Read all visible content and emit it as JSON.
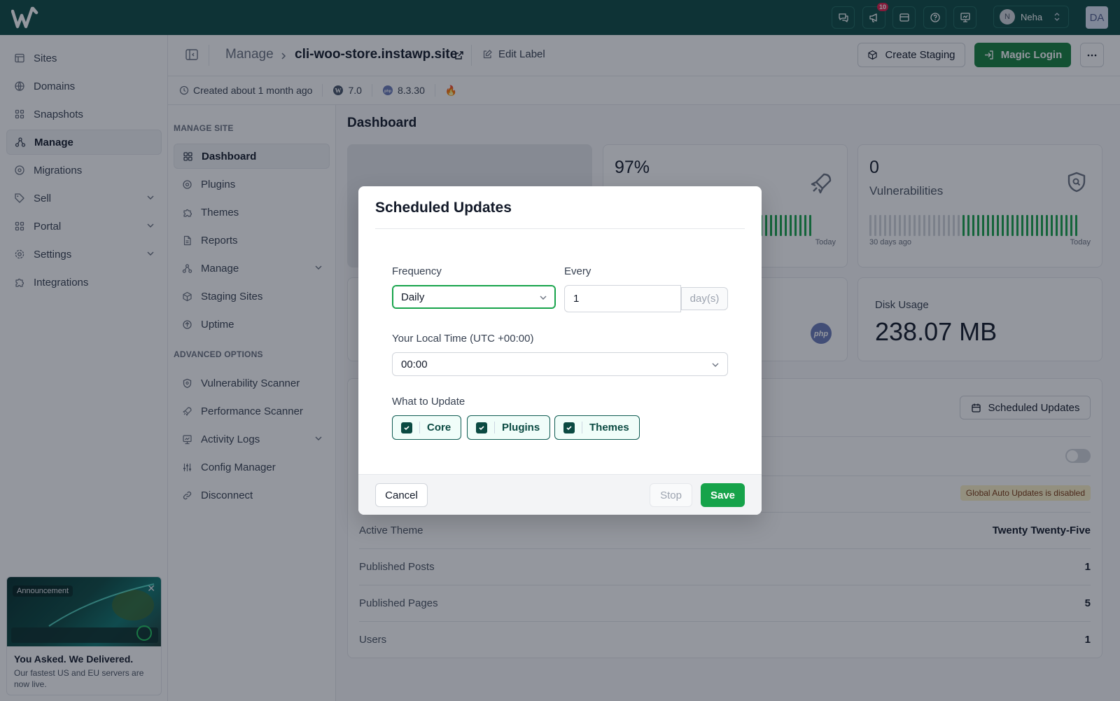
{
  "topbar": {
    "logo_icon": "instawp-logo-icon",
    "icons": [
      "chat-icon",
      "megaphone-icon",
      "ticket-icon",
      "help-icon",
      "presentation-icon"
    ],
    "notification_count": "10",
    "user_initial": "N",
    "user_name": "Neha",
    "account_initials": "DA"
  },
  "sidebar": {
    "items": [
      {
        "label": "Sites",
        "icon": "sites-icon"
      },
      {
        "label": "Domains",
        "icon": "globe-icon"
      },
      {
        "label": "Snapshots",
        "icon": "grid-icon"
      },
      {
        "label": "Manage",
        "icon": "manage-icon",
        "active": true
      },
      {
        "label": "Migrations",
        "icon": "migrations-icon"
      },
      {
        "label": "Sell",
        "icon": "tag-icon",
        "has_chevron": true
      },
      {
        "label": "Portal",
        "icon": "portal-icon",
        "has_chevron": true
      },
      {
        "label": "Settings",
        "icon": "gear-icon",
        "has_chevron": true
      },
      {
        "label": "Integrations",
        "icon": "puzzle-icon"
      }
    ],
    "announcement": {
      "tag": "Announcement",
      "title": "You Asked. We Delivered.",
      "text": "Our fastest US and EU servers are now live."
    }
  },
  "header": {
    "breadcrumb_root": "Manage",
    "site_name": "cli-woo-store.instawp.site",
    "edit_label": "Edit Label",
    "create_staging": "Create Staging",
    "magic_login": "Magic Login"
  },
  "meta": {
    "created": "Created about 1 month ago",
    "wp_version": "7.0",
    "php_version": "8.3.30"
  },
  "subnav": {
    "manage_heading": "MANAGE SITE",
    "manage_items": [
      {
        "label": "Dashboard",
        "icon": "dashboard-icon",
        "active": true
      },
      {
        "label": "Plugins",
        "icon": "plug-icon"
      },
      {
        "label": "Themes",
        "icon": "palette-icon"
      },
      {
        "label": "Reports",
        "icon": "file-icon"
      },
      {
        "label": "Manage",
        "icon": "manage-icon",
        "has_chevron": true
      },
      {
        "label": "Staging Sites",
        "icon": "box-icon"
      },
      {
        "label": "Uptime",
        "icon": "uptime-icon"
      }
    ],
    "advanced_heading": "ADVANCED OPTIONS",
    "advanced_items": [
      {
        "label": "Vulnerability Scanner",
        "icon": "shield-icon"
      },
      {
        "label": "Performance Scanner",
        "icon": "rocket-icon"
      },
      {
        "label": "Activity Logs",
        "icon": "logs-icon",
        "has_chevron": true
      },
      {
        "label": "Config Manager",
        "icon": "sliders-icon"
      },
      {
        "label": "Disconnect",
        "icon": "link-icon"
      }
    ]
  },
  "dashboard": {
    "title": "Dashboard",
    "performance_value": "97%",
    "performance_label_right": "Today",
    "vulnerabilities_value": "0",
    "vulnerabilities_label": "Vulnerabilities",
    "vuln_left_label": "30 days ago",
    "vuln_right_label": "Today",
    "disk_usage_label": "Disk Usage",
    "disk_usage_value": "238.07 MB",
    "scheduled_updates_button": "Scheduled Updates",
    "global_auto_updates": "Global Auto Updates is disabled",
    "rows": [
      {
        "label": "Active Theme",
        "value": "Twenty Twenty-Five"
      },
      {
        "label": "Published Posts",
        "value": "1"
      },
      {
        "label": "Published Pages",
        "value": "5"
      },
      {
        "label": "Users",
        "value": "1"
      }
    ]
  },
  "modal": {
    "title": "Scheduled Updates",
    "frequency_label": "Frequency",
    "frequency_value": "Daily",
    "every_label": "Every",
    "every_value": "1",
    "every_unit": "day(s)",
    "local_time_label": "Your Local Time (UTC +00:00)",
    "local_time_value": "00:00",
    "what_to_update_label": "What to Update",
    "options": [
      {
        "label": "Core",
        "checked": true
      },
      {
        "label": "Plugins",
        "checked": true
      },
      {
        "label": "Themes",
        "checked": true
      }
    ],
    "cancel": "Cancel",
    "stop": "Stop",
    "save": "Save"
  },
  "colors": {
    "topbar": "#0b4a42",
    "accent_green": "#16a34a",
    "badge_red": "#e11d48"
  }
}
